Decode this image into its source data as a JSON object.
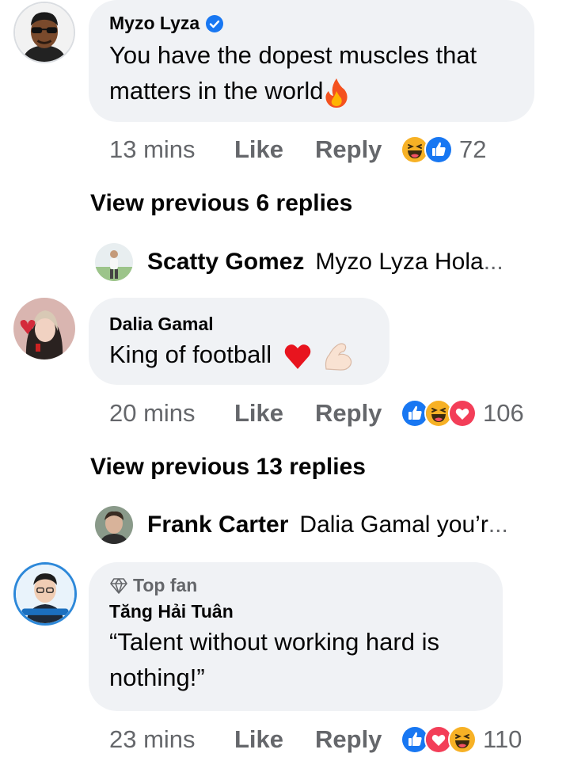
{
  "comments": [
    {
      "author": "Myzo Lyza",
      "verified": true,
      "text_lines": [
        "You have the dopest muscles that",
        "matters in the world"
      ],
      "emoji": "fire",
      "time": "13 mins",
      "like": "Like",
      "reply": "Reply",
      "reactions": [
        "haha",
        "like"
      ],
      "reaction_count": "72",
      "view_previous": "View previous 6 replies",
      "latest_reply": {
        "author": "Scatty Gomez",
        "text": "Myzo Lyza Hola",
        "ellipsis": "..."
      }
    },
    {
      "author": "Dalia Gamal",
      "text": "King of football",
      "emojis": [
        "red-heart",
        "flexed-biceps"
      ],
      "time": "20 mins",
      "like": "Like",
      "reply": "Reply",
      "reactions": [
        "like",
        "haha",
        "love"
      ],
      "reaction_count": "106",
      "view_previous": "View previous 13 replies",
      "latest_reply": {
        "author": "Frank Carter",
        "text": "Dalia Gamal you’r",
        "ellipsis": "..."
      }
    },
    {
      "badge": "Top fan",
      "author": "Tăng Hải Tuân",
      "text_lines": [
        "“Talent without working hard is",
        "nothing!”"
      ],
      "time": "23 mins",
      "like": "Like",
      "reply": "Reply",
      "reactions": [
        "like",
        "love",
        "haha"
      ],
      "reaction_count": "110"
    }
  ],
  "colors": {
    "bubble": "#f0f2f5",
    "meta_text": "#65676b",
    "like_blue": "#1877f2",
    "love_red": "#f33e58",
    "haha_yellow": "#f7b125"
  }
}
